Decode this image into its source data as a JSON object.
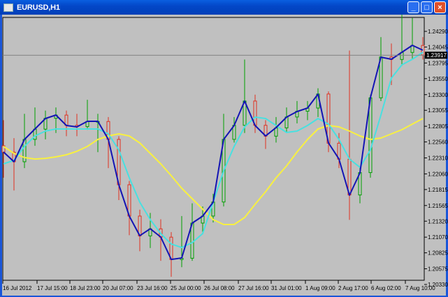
{
  "window": {
    "title": "EURUSD,H1",
    "minimize_label": "_",
    "maximize_label": "□",
    "close_label": "×"
  },
  "chart_data": {
    "type": "candlestick",
    "symbol": "EURUSD",
    "timeframe": "H1",
    "ylim": [
      1.2033,
      1.2429
    ],
    "y_ticks": [
      "1.24290",
      "1.24045",
      "1.23795",
      "1.23550",
      "1.23300",
      "1.23055",
      "1.22805",
      "1.22560",
      "1.22310",
      "1.22060",
      "1.21815",
      "1.21565",
      "1.21320",
      "1.21070",
      "1.20825",
      "1.20575",
      "1.20330"
    ],
    "x_ticks": [
      "16 Jul 2012",
      "17 Jul 15:00",
      "18 Jul 23:00",
      "20 Jul 07:00",
      "23 Jul 16:00",
      "25 Jul 00:00",
      "26 Jul 08:00",
      "27 Jul 16:00",
      "31 Jul 01:00",
      "1 Aug 09:00",
      "2 Aug 17:00",
      "6 Aug 02:00",
      "7 Aug 10:00"
    ],
    "current_price": "1.23917",
    "grid": false,
    "colors": {
      "background": "#c0c0c0",
      "bull": "#00a000",
      "bear": "#e03020",
      "ma_fast": "#1414b4",
      "ma_mid": "#48e0e0",
      "ma_slow": "#f8f040",
      "price_label_bg": "#000000"
    },
    "candles_ohlc": [
      [
        1.225,
        1.229,
        1.22,
        1.224
      ],
      [
        1.224,
        1.2262,
        1.218,
        1.2225
      ],
      [
        1.2225,
        1.23,
        1.2215,
        1.226
      ],
      [
        1.226,
        1.231,
        1.225,
        1.2276
      ],
      [
        1.2276,
        1.2305,
        1.226,
        1.2293
      ],
      [
        1.2293,
        1.231,
        1.227,
        1.2298
      ],
      [
        1.2298,
        1.2305,
        1.2265,
        1.2282
      ],
      [
        1.2282,
        1.23,
        1.2265,
        1.228
      ],
      [
        1.228,
        1.2322,
        1.2275,
        1.2288
      ],
      [
        1.2288,
        1.23,
        1.224,
        1.2288
      ],
      [
        1.2288,
        1.2295,
        1.2215,
        1.226
      ],
      [
        1.226,
        1.2265,
        1.2165,
        1.2189
      ],
      [
        1.2189,
        1.2195,
        1.211,
        1.214
      ],
      [
        1.214,
        1.215,
        1.2085,
        1.2109
      ],
      [
        1.2109,
        1.2145,
        1.209,
        1.212
      ],
      [
        1.212,
        1.2135,
        1.207,
        1.2107
      ],
      [
        1.2107,
        1.2115,
        1.2045,
        1.2072
      ],
      [
        1.2072,
        1.214,
        1.206,
        1.2074
      ],
      [
        1.2074,
        1.216,
        1.207,
        1.2129
      ],
      [
        1.2129,
        1.2155,
        1.2115,
        1.214
      ],
      [
        1.214,
        1.2175,
        1.213,
        1.2162
      ],
      [
        1.2162,
        1.23,
        1.2155,
        1.226
      ],
      [
        1.226,
        1.2295,
        1.2255,
        1.2282
      ],
      [
        1.2282,
        1.2385,
        1.227,
        1.232
      ],
      [
        1.232,
        1.233,
        1.227,
        1.2282
      ],
      [
        1.2282,
        1.229,
        1.2245,
        1.2265
      ],
      [
        1.2265,
        1.2295,
        1.2255,
        1.2278
      ],
      [
        1.2278,
        1.231,
        1.227,
        1.2295
      ],
      [
        1.2295,
        1.232,
        1.2285,
        1.2304
      ],
      [
        1.2304,
        1.232,
        1.229,
        1.2309
      ],
      [
        1.2309,
        1.234,
        1.2295,
        1.2331
      ],
      [
        1.2331,
        1.2335,
        1.224,
        1.2254
      ],
      [
        1.2254,
        1.227,
        1.2215,
        1.2229
      ],
      [
        1.2229,
        1.2399,
        1.2134,
        1.2173
      ],
      [
        1.2173,
        1.2215,
        1.216,
        1.2208
      ],
      [
        1.2208,
        1.233,
        1.22,
        1.2325
      ],
      [
        1.2325,
        1.242,
        1.232,
        1.2389
      ],
      [
        1.2389,
        1.241,
        1.2345,
        1.2385
      ],
      [
        1.2385,
        1.2455,
        1.2375,
        1.2396
      ],
      [
        1.2396,
        1.245,
        1.2385,
        1.2407
      ],
      [
        1.2407,
        1.242,
        1.2385,
        1.2392
      ]
    ],
    "ma_fast": [
      1.22403,
      1.2225,
      1.22599,
      1.22763,
      1.22926,
      1.22981,
      1.22817,
      1.22795,
      1.22883,
      1.22883,
      1.22599,
      1.2189,
      1.21399,
      1.21093,
      1.21202,
      1.21072,
      1.20722,
      1.20744,
      1.2129,
      1.21399,
      1.21617,
      1.22599,
      1.22817,
      1.23199,
      1.22817,
      1.22654,
      1.22784,
      1.22948,
      1.23035,
      1.2309,
      1.23308,
      1.22544,
      1.22293,
      1.21726,
      1.22075,
      1.23254,
      1.23886,
      1.23854,
      1.23963,
      1.24072,
      1.23995
    ],
    "ma_mid": [
      1.22217,
      1.22272,
      1.2249,
      1.22654,
      1.2273,
      1.22763,
      1.22763,
      1.22763,
      1.22763,
      1.22763,
      1.22686,
      1.22435,
      1.21999,
      1.21617,
      1.21344,
      1.21126,
      1.20963,
      1.20908,
      1.20984,
      1.21126,
      1.21617,
      1.22108,
      1.2249,
      1.22795,
      1.22948,
      1.22926,
      1.22817,
      1.22708,
      1.2273,
      1.22817,
      1.22926,
      1.22839,
      1.22599,
      1.22293,
      1.22163,
      1.22435,
      1.22981,
      1.23559,
      1.23766,
      1.23854,
      1.23963
    ],
    "ma_slow": [
      1.2249,
      1.22381,
      1.22315,
      1.22293,
      1.22304,
      1.22326,
      1.22359,
      1.22414,
      1.2249,
      1.22599,
      1.22654,
      1.22686,
      1.22654,
      1.22544,
      1.22381,
      1.22217,
      1.22032,
      1.21835,
      1.21672,
      1.21508,
      1.21344,
      1.21268,
      1.21268,
      1.21377,
      1.21584,
      1.21781,
      1.21999,
      1.22184,
      1.22403,
      1.22599,
      1.22763,
      1.22817,
      1.22795,
      1.2273,
      1.22654,
      1.22599,
      1.22621,
      1.22686,
      1.22752,
      1.22839,
      1.22926
    ]
  }
}
